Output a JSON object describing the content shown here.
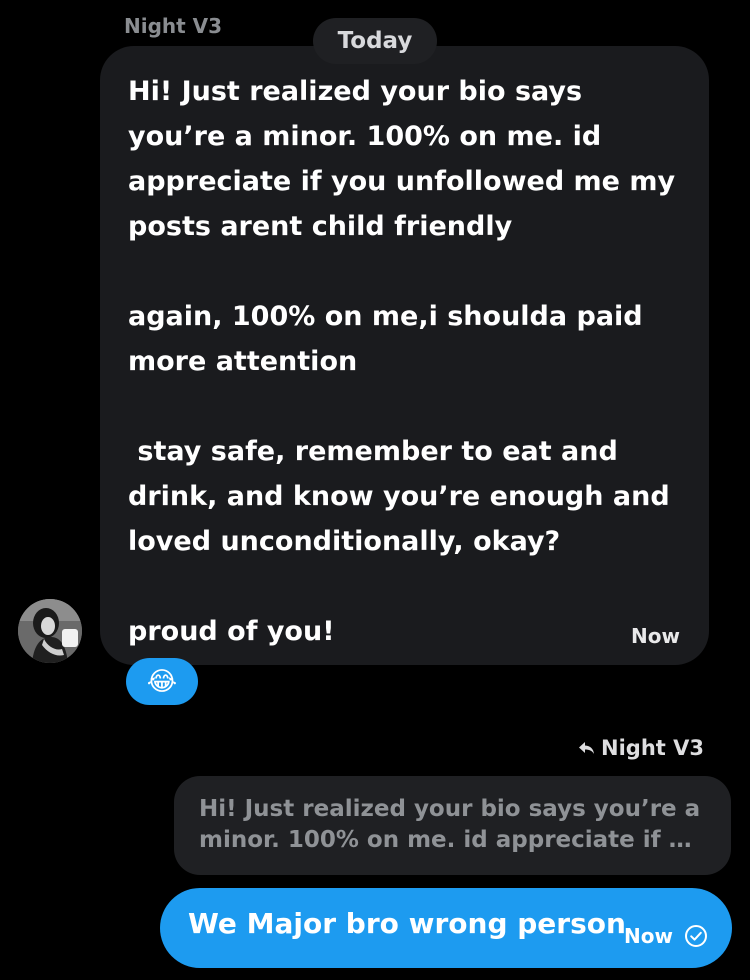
{
  "conversation": {
    "sender_name": "Night V3",
    "date_divider": "Today"
  },
  "incoming_message": {
    "paragraphs": [
      "Hi! Just realized your bio says\nyou’re a minor. 100% on me. id\nappreciate if you unfollowed me my\nposts arent child friendly",
      "again, 100% on me,i shoulda paid\nmore attention",
      " stay safe, remember to eat and\ndrink, and know you’re enough and\nloved unconditionally, okay?",
      "proud of you!"
    ],
    "time": "Now",
    "reaction_emoji": "😂"
  },
  "reply": {
    "reply_to_name": "Night V3",
    "quoted_lines": [
      "Hi! Just realized your bio says you’re a",
      "minor. 100% on me. id appreciate if yo..."
    ]
  },
  "outgoing_message": {
    "text": "We Major bro wrong person",
    "time": "Now",
    "status_icon": "check-circle-icon"
  },
  "colors": {
    "background": "#000000",
    "incoming_bubble": "#1a1b1e",
    "accent_blue": "#1d9bf0",
    "muted_text": "#8a8d91"
  }
}
